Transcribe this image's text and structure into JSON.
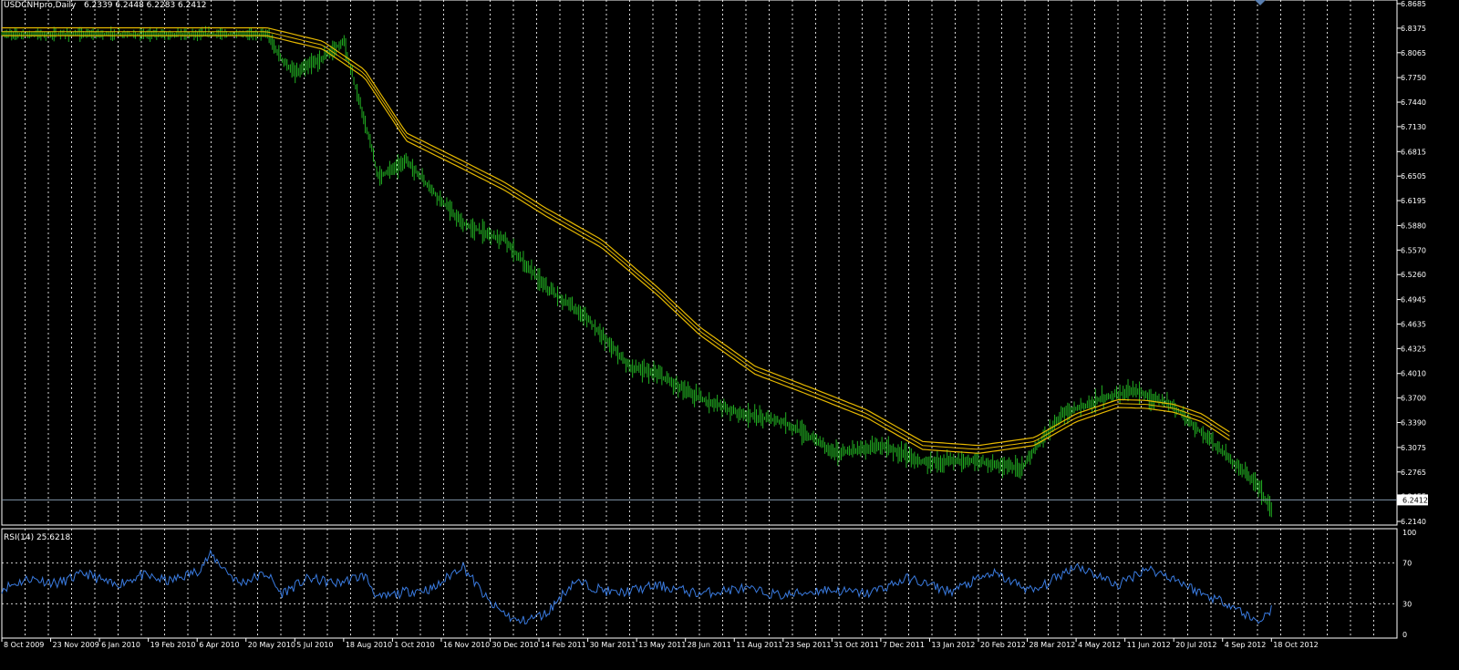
{
  "header": {
    "symbol_label": "USDCNHpro,Daily",
    "ohlc_label": "6.2339 6.2448 6.2283 6.2412"
  },
  "rsi_panel": {
    "label": "RSI(14) 25.6218",
    "levels": [
      "100",
      "70",
      "30",
      "0"
    ]
  },
  "colors": {
    "background": "#000000",
    "bars": "#22b022",
    "ma": "#e6b800",
    "rsi": "#3a7be0",
    "grid": "#ffffff",
    "price_line": "#7f95a8"
  },
  "chart_data": {
    "type": "line",
    "title": "USDCNHpro,Daily",
    "x_tick_labels": [
      "8 Oct 2009",
      "23 Nov 2009",
      "6 Jan 2010",
      "19 Feb 2010",
      "6 Apr 2010",
      "20 May 2010",
      "5 Jul 2010",
      "18 Aug 2010",
      "1 Oct 2010",
      "16 Nov 2010",
      "30 Dec 2010",
      "14 Feb 2011",
      "30 Mar 2011",
      "13 May 2011",
      "28 Jun 2011",
      "11 Aug 2011",
      "23 Sep 2011",
      "31 Oct 2011",
      "7 Dec 2011",
      "13 Jan 2012",
      "20 Feb 2012",
      "28 Mar 2012",
      "4 May 2012",
      "11 Jun 2012",
      "20 Jul 2012",
      "4 Sep 2012",
      "18 Oct 2012"
    ],
    "y_tick_labels": [
      "6.8685",
      "6.8375",
      "6.8065",
      "6.7750",
      "6.7440",
      "6.7130",
      "6.6815",
      "6.6505",
      "6.6195",
      "6.5880",
      "6.5570",
      "6.5260",
      "6.4945",
      "6.4635",
      "6.4325",
      "6.4010",
      "6.3700",
      "6.3390",
      "6.3075",
      "6.2765",
      "6.2455",
      "6.2140"
    ],
    "ylim": [
      6.214,
      6.8685
    ],
    "current_price": "6.2412",
    "price_series": {
      "name": "USDCNHpro",
      "x": [
        0,
        0.08,
        0.16,
        0.19,
        0.2,
        0.21,
        0.23,
        0.245,
        0.26,
        0.27,
        0.29,
        0.31,
        0.33,
        0.36,
        0.39,
        0.42,
        0.45,
        0.47,
        0.5,
        0.53,
        0.56,
        0.6,
        0.63,
        0.66,
        0.7,
        0.73,
        0.76,
        0.79,
        0.81,
        0.84,
        0.87,
        0.9,
        0.91
      ],
      "values": [
        6.83,
        6.83,
        6.83,
        6.83,
        6.8,
        6.78,
        6.8,
        6.82,
        6.72,
        6.65,
        6.67,
        6.63,
        6.59,
        6.57,
        6.51,
        6.47,
        6.41,
        6.4,
        6.37,
        6.35,
        6.34,
        6.3,
        6.31,
        6.29,
        6.29,
        6.28,
        6.35,
        6.37,
        6.38,
        6.36,
        6.31,
        6.26,
        6.23
      ]
    },
    "ma_series": {
      "name": "",
      "x": [
        0,
        0.19,
        0.23,
        0.26,
        0.29,
        0.33,
        0.36,
        0.39,
        0.43,
        0.47,
        0.5,
        0.54,
        0.58,
        0.62,
        0.66,
        0.7,
        0.74,
        0.77,
        0.8,
        0.82,
        0.84,
        0.86,
        0.88
      ],
      "values": [
        6.833,
        6.833,
        6.816,
        6.78,
        6.7,
        6.665,
        6.638,
        6.605,
        6.565,
        6.505,
        6.455,
        6.405,
        6.378,
        6.35,
        6.31,
        6.305,
        6.315,
        6.345,
        6.363,
        6.362,
        6.357,
        6.345,
        6.322
      ]
    },
    "rsi": {
      "name": "RSI(14)",
      "ylim": [
        0,
        100
      ],
      "levels": [
        70,
        30
      ],
      "x": [
        0,
        0.02,
        0.04,
        0.06,
        0.08,
        0.1,
        0.12,
        0.14,
        0.15,
        0.17,
        0.19,
        0.2,
        0.22,
        0.24,
        0.26,
        0.27,
        0.29,
        0.31,
        0.33,
        0.35,
        0.37,
        0.39,
        0.41,
        0.44,
        0.47,
        0.5,
        0.53,
        0.56,
        0.59,
        0.62,
        0.65,
        0.68,
        0.71,
        0.74,
        0.77,
        0.8,
        0.82,
        0.84,
        0.86,
        0.88,
        0.9,
        0.91
      ],
      "values": [
        45,
        55,
        50,
        60,
        48,
        58,
        52,
        62,
        78,
        50,
        60,
        40,
        55,
        50,
        58,
        35,
        42,
        45,
        68,
        30,
        12,
        20,
        52,
        40,
        48,
        40,
        45,
        38,
        44,
        40,
        55,
        42,
        60,
        42,
        68,
        48,
        65,
        55,
        40,
        30,
        12,
        25
      ]
    }
  }
}
